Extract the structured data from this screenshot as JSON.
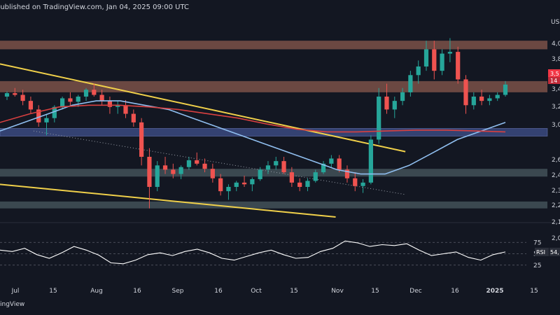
{
  "header": {
    "published_text": "published on TradingView.com, Jan 04, 2025 09:00 UTC"
  },
  "branding": {
    "footer_text": "ingView"
  },
  "price_axis": {
    "unit_fragment": "US",
    "ticks": [
      "4,0",
      "3,8",
      "3,4",
      "3,2",
      "3,0",
      "2,6",
      "2,4",
      "2,3",
      "2,2",
      "2,1",
      "2,0"
    ],
    "current_price_label": "3,5",
    "countdown_label": "14"
  },
  "time_axis": {
    "ticks": [
      "Jul",
      "15",
      "Aug",
      "16",
      "Sep",
      "16",
      "Oct",
      "15",
      "Nov",
      "15",
      "Dec",
      "16",
      "2025",
      "15"
    ]
  },
  "rsi": {
    "label": "RSI",
    "value": "54,",
    "levels": [
      "75",
      "50",
      "25"
    ]
  },
  "colors": {
    "background": "#131722",
    "candle_up": "#26a69a",
    "candle_down": "#ef5350",
    "supply_zone": "#8a5a4e",
    "demand_zone": "#4a5a60",
    "blue_zone": "#3a4a80",
    "trendline": "#f0d04a",
    "ma_short": "#90bff0",
    "ma_long": "#d84040",
    "rsi_line": "#ffffff"
  },
  "chart_data": {
    "type": "candlestick",
    "y_scale": {
      "min": 2.0,
      "max": 4.1
    },
    "x_range": [
      "2024-06-24",
      "2025-01-22"
    ],
    "zones": [
      {
        "kind": "resistance",
        "low": 3.95,
        "high": 4.05
      },
      {
        "kind": "resistance",
        "low": 3.45,
        "high": 3.58
      },
      {
        "kind": "support",
        "low": 2.94,
        "high": 3.03
      },
      {
        "kind": "support",
        "low": 2.47,
        "high": 2.56
      },
      {
        "kind": "support",
        "low": 2.1,
        "high": 2.18
      }
    ],
    "series": [
      {
        "values": [
          [
            3.4,
            3.46,
            3.36,
            3.44
          ],
          [
            3.44,
            3.5,
            3.4,
            3.42
          ],
          [
            3.42,
            3.48,
            3.3,
            3.35
          ],
          [
            3.35,
            3.4,
            3.2,
            3.25
          ],
          [
            3.25,
            3.3,
            3.05,
            3.1
          ],
          [
            3.1,
            3.2,
            2.95,
            3.15
          ],
          [
            3.15,
            3.3,
            3.1,
            3.28
          ],
          [
            3.28,
            3.4,
            3.25,
            3.38
          ],
          [
            3.38,
            3.45,
            3.3,
            3.34
          ],
          [
            3.34,
            3.42,
            3.28,
            3.4
          ],
          [
            3.4,
            3.5,
            3.35,
            3.48
          ],
          [
            3.48,
            3.55,
            3.4,
            3.42
          ],
          [
            3.42,
            3.48,
            3.3,
            3.35
          ],
          [
            3.35,
            3.4,
            3.2,
            3.28
          ],
          [
            3.28,
            3.35,
            3.2,
            3.3
          ],
          [
            3.3,
            3.36,
            3.15,
            3.2
          ],
          [
            3.2,
            3.25,
            3.05,
            3.1
          ],
          [
            3.1,
            3.15,
            2.6,
            2.7
          ],
          [
            2.7,
            2.8,
            2.1,
            2.35
          ],
          [
            2.35,
            2.65,
            2.3,
            2.6
          ],
          [
            2.6,
            2.7,
            2.5,
            2.55
          ],
          [
            2.55,
            2.62,
            2.45,
            2.5
          ],
          [
            2.5,
            2.6,
            2.44,
            2.58
          ],
          [
            2.58,
            2.7,
            2.55,
            2.66
          ],
          [
            2.66,
            2.75,
            2.6,
            2.62
          ],
          [
            2.62,
            2.68,
            2.52,
            2.56
          ],
          [
            2.56,
            2.62,
            2.4,
            2.45
          ],
          [
            2.45,
            2.5,
            2.25,
            2.3
          ],
          [
            2.3,
            2.38,
            2.2,
            2.35
          ],
          [
            2.35,
            2.42,
            2.3,
            2.4
          ],
          [
            2.4,
            2.48,
            2.35,
            2.38
          ],
          [
            2.38,
            2.46,
            2.3,
            2.44
          ],
          [
            2.44,
            2.58,
            2.42,
            2.55
          ],
          [
            2.55,
            2.65,
            2.5,
            2.6
          ],
          [
            2.6,
            2.7,
            2.55,
            2.65
          ],
          [
            2.65,
            2.7,
            2.5,
            2.52
          ],
          [
            2.52,
            2.58,
            2.35,
            2.4
          ],
          [
            2.4,
            2.45,
            2.3,
            2.35
          ],
          [
            2.35,
            2.45,
            2.3,
            2.42
          ],
          [
            2.42,
            2.55,
            2.4,
            2.52
          ],
          [
            2.52,
            2.65,
            2.5,
            2.62
          ],
          [
            2.62,
            2.72,
            2.58,
            2.68
          ],
          [
            2.68,
            2.72,
            2.52,
            2.55
          ],
          [
            2.55,
            2.6,
            2.4,
            2.45
          ],
          [
            2.45,
            2.52,
            2.3,
            2.36
          ],
          [
            2.36,
            2.44,
            2.28,
            2.4
          ],
          [
            2.4,
            2.95,
            2.38,
            2.9
          ],
          [
            2.9,
            3.5,
            2.85,
            3.4
          ],
          [
            3.4,
            3.55,
            3.2,
            3.25
          ],
          [
            3.25,
            3.4,
            3.15,
            3.35
          ],
          [
            3.35,
            3.5,
            3.3,
            3.45
          ],
          [
            3.45,
            3.7,
            3.4,
            3.65
          ],
          [
            3.65,
            3.82,
            3.55,
            3.75
          ],
          [
            3.75,
            4.05,
            3.7,
            3.95
          ],
          [
            3.95,
            4.05,
            3.6,
            3.7
          ],
          [
            3.7,
            3.95,
            3.65,
            3.9
          ],
          [
            3.9,
            4.08,
            3.8,
            3.92
          ],
          [
            3.92,
            3.98,
            3.55,
            3.6
          ],
          [
            3.6,
            3.65,
            3.2,
            3.3
          ],
          [
            3.3,
            3.45,
            3.25,
            3.4
          ],
          [
            3.4,
            3.48,
            3.3,
            3.35
          ],
          [
            3.35,
            3.42,
            3.3,
            3.38
          ],
          [
            3.38,
            3.45,
            3.35,
            3.42
          ],
          [
            3.42,
            3.58,
            3.4,
            3.54
          ]
        ]
      },
      {
        "name": "MA short",
        "values": [
          3.0,
          3.1,
          3.2,
          3.3,
          3.35,
          3.35,
          3.3,
          3.25,
          3.15,
          3.05,
          2.95,
          2.85,
          2.75,
          2.65,
          2.55,
          2.5,
          2.5,
          2.6,
          2.75,
          2.9,
          3.0,
          3.1
        ]
      },
      {
        "name": "MA long",
        "values": [
          3.1,
          3.2,
          3.28,
          3.3,
          3.3,
          3.28,
          3.25,
          3.2,
          3.15,
          3.08,
          3.02,
          2.99,
          2.99,
          3.0,
          3.01,
          3.01,
          3.0,
          2.99
        ]
      },
      {
        "name": "RSI",
        "values": [
          58,
          55,
          62,
          48,
          40,
          52,
          66,
          58,
          47,
          30,
          28,
          36,
          48,
          52,
          46,
          55,
          60,
          52,
          40,
          36,
          44,
          52,
          58,
          48,
          40,
          42,
          55,
          62,
          78,
          74,
          66,
          70,
          68,
          72,
          58,
          46,
          50,
          54,
          42,
          36,
          48,
          54
        ]
      }
    ],
    "trendlines": [
      {
        "from": [
          "2024-06-24",
          3.78
        ],
        "to": [
          "2024-11-28",
          2.76
        ]
      },
      {
        "from": [
          "2024-06-24",
          2.38
        ],
        "to": [
          "2024-11-01",
          2.0
        ]
      }
    ]
  }
}
